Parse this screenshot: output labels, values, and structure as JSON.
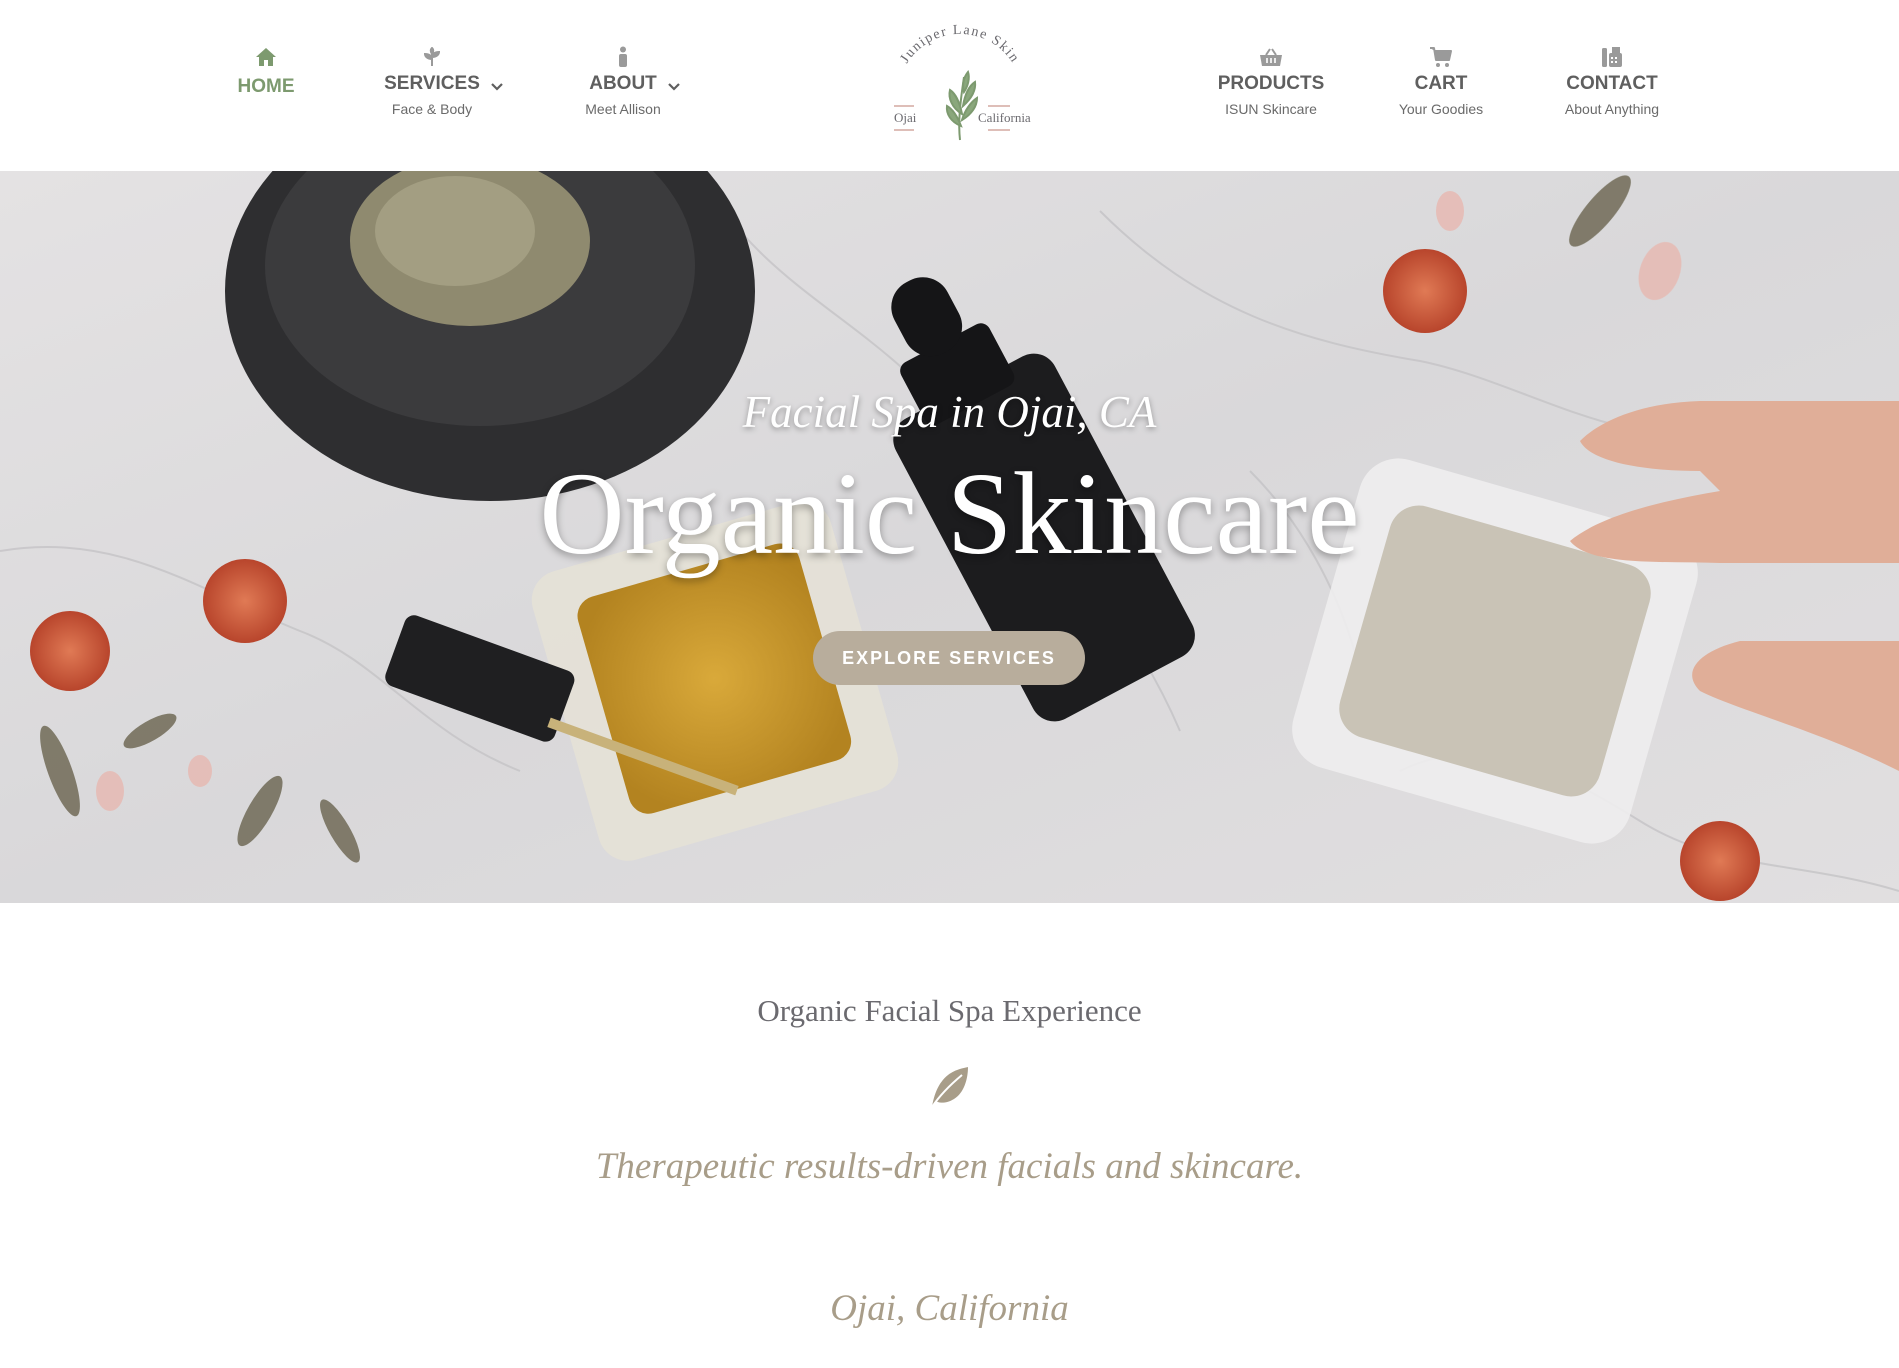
{
  "nav": {
    "home": {
      "label": "HOME",
      "icon": "home-icon"
    },
    "services": {
      "label": "SERVICES",
      "sub": "Face & Body",
      "icon": "plant-icon"
    },
    "about": {
      "label": "ABOUT",
      "sub": "Meet Allison",
      "icon": "person-icon"
    },
    "products": {
      "label": "PRODUCTS",
      "sub": "ISUN Skincare",
      "icon": "basket-icon"
    },
    "cart": {
      "label": "CART",
      "sub": "Your Goodies",
      "icon": "cart-icon"
    },
    "contact": {
      "label": "CONTACT",
      "sub": "About Anything",
      "icon": "fax-icon"
    }
  },
  "logo": {
    "arc_text": "Juniper Lane Skin",
    "left_text": "Ojai",
    "right_text": "California"
  },
  "hero": {
    "subtitle": "Facial Spa in Ojai, CA",
    "title": "Organic Skincare",
    "button": "EXPLORE SERVICES"
  },
  "intro": {
    "title": "Organic Facial Spa Experience",
    "icon": "leaf-icon",
    "tagline": "Therapeutic results-driven facials and skincare.",
    "location": "Ojai, California"
  },
  "colors": {
    "accent_green": "#7d9a6f",
    "button_tan": "#b8ad9c",
    "italic_tan": "#a89d89",
    "nav_text": "#5f5f5f"
  }
}
